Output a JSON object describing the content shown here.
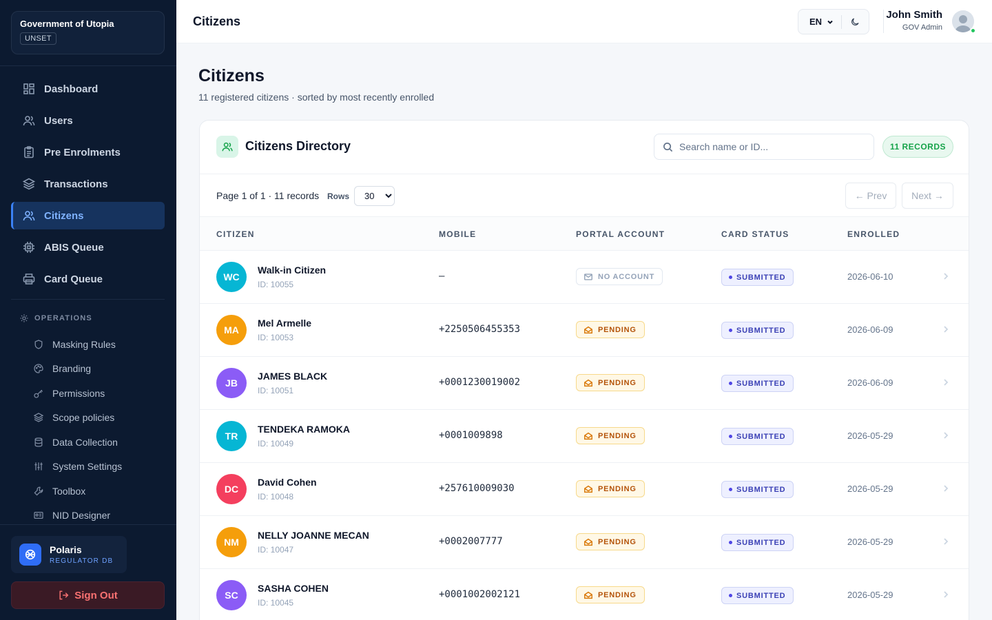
{
  "sidebar": {
    "org_name": "Government of Utopia",
    "org_tag": "UNSET",
    "nav": [
      {
        "label": "Dashboard",
        "icon": "dashboard-icon"
      },
      {
        "label": "Users",
        "icon": "users-icon"
      },
      {
        "label": "Pre Enrolments",
        "icon": "clipboard-icon"
      },
      {
        "label": "Transactions",
        "icon": "layers-icon"
      },
      {
        "label": "Citizens",
        "icon": "users-icon",
        "active": true
      },
      {
        "label": "ABIS Queue",
        "icon": "chip-icon"
      },
      {
        "label": "Card Queue",
        "icon": "printer-icon"
      }
    ],
    "operations_heading": "OPERATIONS",
    "operations": [
      {
        "label": "Masking Rules",
        "icon": "shield-icon"
      },
      {
        "label": "Branding",
        "icon": "palette-icon"
      },
      {
        "label": "Permissions",
        "icon": "key-icon"
      },
      {
        "label": "Scope policies",
        "icon": "layers-icon"
      },
      {
        "label": "Data Collection",
        "icon": "database-icon"
      },
      {
        "label": "System Settings",
        "icon": "sliders-icon"
      },
      {
        "label": "Toolbox",
        "icon": "wrench-icon"
      },
      {
        "label": "NID Designer",
        "icon": "id-card-icon"
      }
    ],
    "db_name": "Polaris",
    "db_sub": "REGULATOR DB",
    "sign_out": "Sign Out"
  },
  "topbar": {
    "title": "Citizens",
    "language": "EN",
    "user_name": "John Smith",
    "user_role": "GOV Admin"
  },
  "page": {
    "title": "Citizens",
    "subtitle": "11 registered citizens · sorted by most recently enrolled"
  },
  "directory": {
    "title": "Citizens Directory",
    "search_placeholder": "Search name or ID...",
    "records_badge": "11 RECORDS",
    "page_info": "Page 1 of 1 · 11 records",
    "rows_label": "Rows",
    "rows_value": "30",
    "prev": "← Prev",
    "next": "Next →",
    "columns": [
      "CITIZEN",
      "MOBILE",
      "PORTAL ACCOUNT",
      "CARD STATUS",
      "ENROLLED"
    ],
    "rows": [
      {
        "initials": "WC",
        "color": "#06b6d4",
        "name": "Walk-in Citizen",
        "id": "ID: 10055",
        "mobile": "—",
        "portal": "NO ACCOUNT",
        "portal_type": "none",
        "status": "SUBMITTED",
        "enrolled": "2026-06-10"
      },
      {
        "initials": "MA",
        "color": "#f59e0b",
        "name": "Mel Armelle",
        "id": "ID: 10053",
        "mobile": "+2250506455353",
        "portal": "PENDING",
        "portal_type": "pending",
        "status": "SUBMITTED",
        "enrolled": "2026-06-09"
      },
      {
        "initials": "JB",
        "color": "#8b5cf6",
        "name": "JAMES BLACK",
        "id": "ID: 10051",
        "mobile": "+0001230019002",
        "portal": "PENDING",
        "portal_type": "pending",
        "status": "SUBMITTED",
        "enrolled": "2026-06-09"
      },
      {
        "initials": "TR",
        "color": "#06b6d4",
        "name": "TENDEKA RAMOKA",
        "id": "ID: 10049",
        "mobile": "+0001009898",
        "portal": "PENDING",
        "portal_type": "pending",
        "status": "SUBMITTED",
        "enrolled": "2026-05-29"
      },
      {
        "initials": "DC",
        "color": "#f43f5e",
        "name": "David Cohen",
        "id": "ID: 10048",
        "mobile": "+257610009030",
        "portal": "PENDING",
        "portal_type": "pending",
        "status": "SUBMITTED",
        "enrolled": "2026-05-29"
      },
      {
        "initials": "NM",
        "color": "#f59e0b",
        "name": "NELLY JOANNE MECAN",
        "id": "ID: 10047",
        "mobile": "+0002007777",
        "portal": "PENDING",
        "portal_type": "pending",
        "status": "SUBMITTED",
        "enrolled": "2026-05-29"
      },
      {
        "initials": "SC",
        "color": "#8b5cf6",
        "name": "SASHA COHEN",
        "id": "ID: 10045",
        "mobile": "+0001002002121",
        "portal": "PENDING",
        "portal_type": "pending",
        "status": "SUBMITTED",
        "enrolled": "2026-05-29"
      }
    ]
  }
}
